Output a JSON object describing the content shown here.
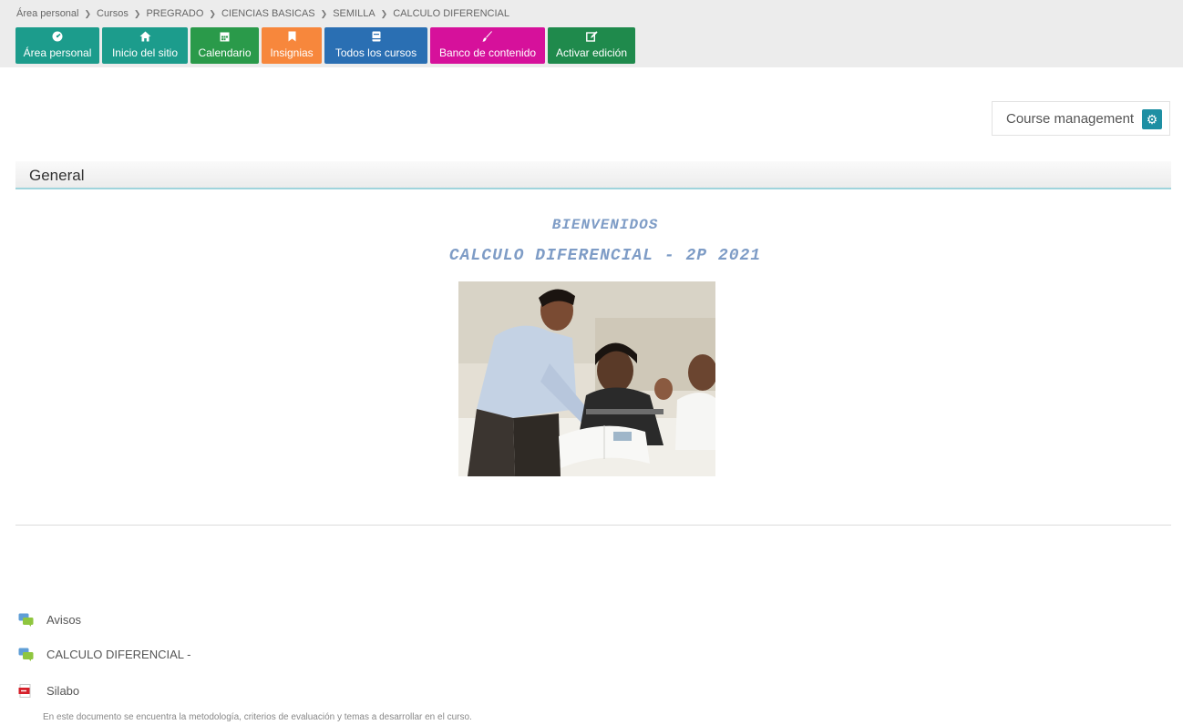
{
  "breadcrumb": {
    "items": [
      "Área personal",
      "Cursos",
      "PREGRADO",
      "CIENCIAS BASICAS",
      "SEMILLA",
      "CALCULO DIFERENCIAL"
    ]
  },
  "nav": {
    "buttons": [
      {
        "label": "Área personal",
        "icon": "dashboard-icon",
        "color": "#1c9c8c"
      },
      {
        "label": "Inicio del sitio",
        "icon": "home-icon",
        "color": "#1c9c8c"
      },
      {
        "label": "Calendario",
        "icon": "calendar-icon",
        "color": "#2a9a4a"
      },
      {
        "label": "Insignias",
        "icon": "bookmark-icon",
        "color": "#f7873c"
      },
      {
        "label": "Todos los cursos",
        "icon": "book-icon",
        "color": "#2a6fb3"
      },
      {
        "label": "Banco de contenido",
        "icon": "brush-icon",
        "color": "#d6119b"
      },
      {
        "label": "Activar edición",
        "icon": "edit-icon",
        "color": "#1f8a4c"
      }
    ]
  },
  "course_management": {
    "label": "Course management",
    "icon": "gear-icon",
    "color": "#1e8fa3"
  },
  "section": {
    "title": "General"
  },
  "welcome": {
    "line1": "BIENVENIDOS",
    "line2": "CALCULO DIFERENCIAL - 2P 2021",
    "color": "#7e9cc6"
  },
  "activities": [
    {
      "label": "Avisos",
      "icon": "forum-icon"
    },
    {
      "label": "CALCULO DIFERENCIAL -",
      "icon": "forum-icon"
    },
    {
      "label": "Silabo",
      "icon": "pdf-icon"
    }
  ],
  "silabo_description": "En este documento se encuentra la metodología, criterios de evaluación y temas a desarrollar en el curso."
}
